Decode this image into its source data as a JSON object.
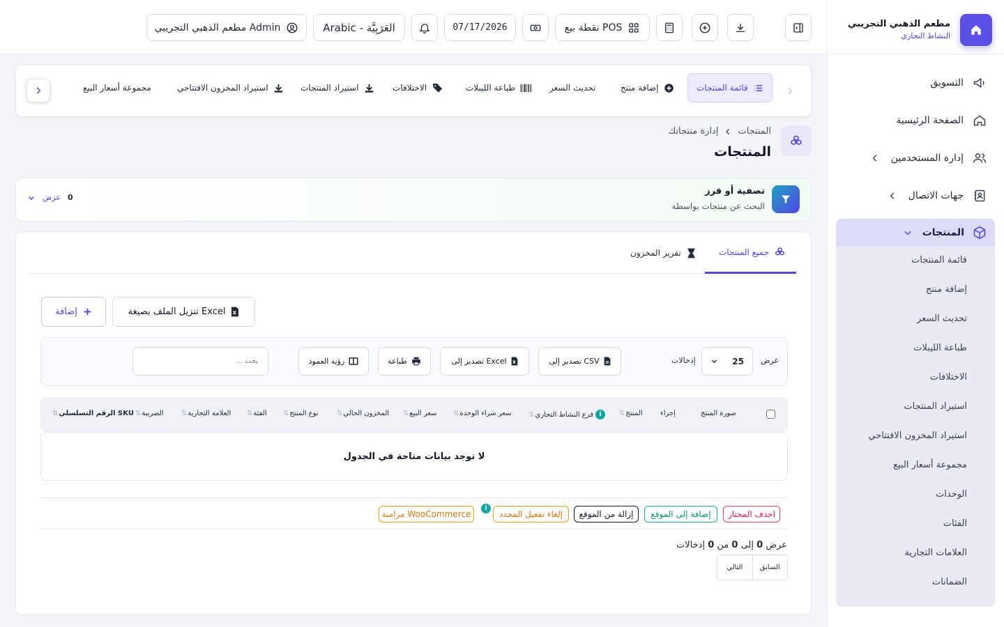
{
  "colors": {
    "accent": "#4f46e5",
    "accent_bg": "#ecebff",
    "danger": "#e11d48",
    "success": "#10b981",
    "warning": "#f59e0b"
  },
  "sidebar": {
    "business_name": "مطعم الذهبي التجريبي",
    "business_subtitle": "النشاط التجاري",
    "items": [
      {
        "label": "التسويق",
        "icon": "megaphone-icon"
      },
      {
        "label": "الصفحة الرئيسية",
        "icon": "home-icon"
      },
      {
        "label": "إدارة المستخدمين",
        "icon": "users-icon"
      },
      {
        "label": "جهات الاتصال",
        "icon": "contacts-icon"
      }
    ],
    "products_group": {
      "label": "المنتجات",
      "icon": "box-icon",
      "subitems": [
        "قائمة المنتجات",
        "إضافة منتج",
        "تحديث السعر",
        "طباعة الليبلات",
        "الاختلافات",
        "استيراد المنتجات",
        "استيراد المخزون الافتتاحي",
        "مجموعة أسعار البيع",
        "الوحدات",
        "الفئات",
        "العلامات التجارية",
        "الضمانات"
      ]
    }
  },
  "header": {
    "user_label": "مطعم الذهبي التجريبي Admin",
    "language_label": "Arabic - العَرَبِيَّة",
    "date": "07/17/2026",
    "pos_label": "نقطة بيع POS"
  },
  "nav_tabs": [
    "قائمة المنتجات",
    "إضافة منتج",
    "تحديث السعر",
    "طباعة الليبلات",
    "الاختلافات",
    "استيراد المنتجات",
    "استيراد المخزون الافتتاحي",
    "مجموعة أسعار البيع"
  ],
  "page": {
    "breadcrumb_root": "المنتجات",
    "breadcrumb_current": "إدارة منتجاتك",
    "title": "المنتجات"
  },
  "filter": {
    "title": "تصفية أو فرز",
    "subtitle": "البحث عن منتجات بواسطة",
    "count": "0",
    "show_label": "عرض"
  },
  "card": {
    "tabs": [
      "جميع المنتجات",
      "تقرير المخزون"
    ],
    "add_button": "إضافة",
    "download_excel_button": "تنزيل الملف بصيغة Excel",
    "show_label": "عرض",
    "entries_value": "25",
    "entries_label": "إدخالات",
    "export_csv": "تصدير إلى CSV",
    "export_excel": "تصدير إلى Excel",
    "print": "طباعة",
    "column_visibility": "رؤية العمود",
    "search_placeholder": "بحث ...",
    "columns": [
      "صورة المنتج",
      "إجراء",
      "المنتج",
      "فرع النشاط التجاري",
      "سعر شراء الوحدة",
      "سعر البيع",
      "المخزون الحالي",
      "نوع المنتج",
      "الفئة",
      "العلامة التجارية",
      "الضريبة",
      "الرقم التسلسلي SKU"
    ],
    "empty_message": "لا توجد بيانات متاحة في الجدول",
    "bulk_actions": {
      "delete_selected": "احذف المختار",
      "add_to_site": "إضافة إلى الموقع",
      "remove_from_site": "إزالة من الموقع",
      "deactivate_selected": "إلغاء تفعيل المحدد",
      "woocommerce_sync": "مزامنة WooCommerce"
    },
    "showing": {
      "prefix": "عرض",
      "from": "0",
      "to_word": "إلى",
      "to": "0",
      "of_word": "من",
      "total": "0",
      "suffix": "إدخالات"
    },
    "pager": {
      "previous": "السابق",
      "next": "التالي"
    }
  }
}
